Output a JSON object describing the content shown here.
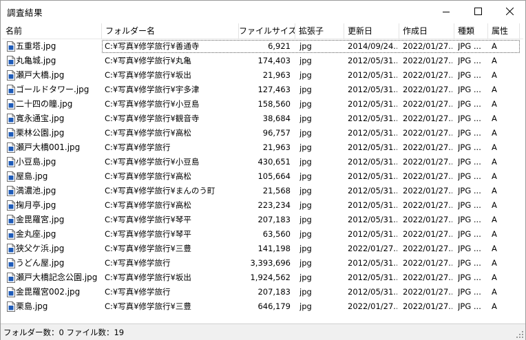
{
  "window": {
    "title": "調査結果"
  },
  "columns": [
    {
      "label": "名前"
    },
    {
      "label": "フォルダー名"
    },
    {
      "label": "ファイルサイズ"
    },
    {
      "label": "拡張子"
    },
    {
      "label": "更新日"
    },
    {
      "label": "作成日"
    },
    {
      "label": "種類"
    },
    {
      "label": "属性"
    }
  ],
  "rows": [
    {
      "name": "五重塔.jpg",
      "folder": "C:¥写真¥修学旅行¥善通寺",
      "size": "6,921",
      "ext": "jpg",
      "updated": "2014/09/24...",
      "created": "2022/01/27...",
      "type": "JPG ...",
      "attr": "A"
    },
    {
      "name": "丸亀城.jpg",
      "folder": "C:¥写真¥修学旅行¥丸亀",
      "size": "174,403",
      "ext": "jpg",
      "updated": "2012/05/31...",
      "created": "2022/01/27...",
      "type": "JPG ...",
      "attr": "A"
    },
    {
      "name": "瀬戸大橋.jpg",
      "folder": "C:¥写真¥修学旅行¥坂出",
      "size": "21,963",
      "ext": "jpg",
      "updated": "2012/05/31...",
      "created": "2022/01/27...",
      "type": "JPG ...",
      "attr": "A"
    },
    {
      "name": "ゴールドタワー.jpg",
      "folder": "C:¥写真¥修学旅行¥宇多津",
      "size": "127,463",
      "ext": "jpg",
      "updated": "2012/05/31...",
      "created": "2022/01/27...",
      "type": "JPG ...",
      "attr": "A"
    },
    {
      "name": "二十四の瞳.jpg",
      "folder": "C:¥写真¥修学旅行¥小豆島",
      "size": "158,560",
      "ext": "jpg",
      "updated": "2012/05/31...",
      "created": "2022/01/27...",
      "type": "JPG ...",
      "attr": "A"
    },
    {
      "name": "寛永通宝.jpg",
      "folder": "C:¥写真¥修学旅行¥観音寺",
      "size": "38,684",
      "ext": "jpg",
      "updated": "2012/05/31...",
      "created": "2022/01/27...",
      "type": "JPG ...",
      "attr": "A"
    },
    {
      "name": "栗林公園.jpg",
      "folder": "C:¥写真¥修学旅行¥高松",
      "size": "96,757",
      "ext": "jpg",
      "updated": "2012/05/31...",
      "created": "2022/01/27...",
      "type": "JPG ...",
      "attr": "A"
    },
    {
      "name": "瀬戸大橋001.jpg",
      "folder": "C:¥写真¥修学旅行",
      "size": "21,963",
      "ext": "jpg",
      "updated": "2012/05/31...",
      "created": "2022/01/27...",
      "type": "JPG ...",
      "attr": "A"
    },
    {
      "name": "小豆島.jpg",
      "folder": "C:¥写真¥修学旅行¥小豆島",
      "size": "430,651",
      "ext": "jpg",
      "updated": "2012/05/31...",
      "created": "2022/01/27...",
      "type": "JPG ...",
      "attr": "A"
    },
    {
      "name": "屋島.jpg",
      "folder": "C:¥写真¥修学旅行¥高松",
      "size": "105,664",
      "ext": "jpg",
      "updated": "2012/05/31...",
      "created": "2022/01/27...",
      "type": "JPG ...",
      "attr": "A"
    },
    {
      "name": "満濃池.jpg",
      "folder": "C:¥写真¥修学旅行¥まんのう町",
      "size": "21,568",
      "ext": "jpg",
      "updated": "2012/05/31...",
      "created": "2022/01/27...",
      "type": "JPG ...",
      "attr": "A"
    },
    {
      "name": "掬月亭.jpg",
      "folder": "C:¥写真¥修学旅行¥高松",
      "size": "223,234",
      "ext": "jpg",
      "updated": "2012/05/31...",
      "created": "2022/01/27...",
      "type": "JPG ...",
      "attr": "A"
    },
    {
      "name": "金毘羅宮.jpg",
      "folder": "C:¥写真¥修学旅行¥琴平",
      "size": "207,183",
      "ext": "jpg",
      "updated": "2012/05/31...",
      "created": "2022/01/27...",
      "type": "JPG ...",
      "attr": "A"
    },
    {
      "name": "金丸座.jpg",
      "folder": "C:¥写真¥修学旅行¥琴平",
      "size": "63,560",
      "ext": "jpg",
      "updated": "2012/05/31...",
      "created": "2022/01/27...",
      "type": "JPG ...",
      "attr": "A"
    },
    {
      "name": "狭父ケ浜.jpg",
      "folder": "C:¥写真¥修学旅行¥三豊",
      "size": "141,198",
      "ext": "jpg",
      "updated": "2022/01/27...",
      "created": "2022/01/27...",
      "type": "JPG ...",
      "attr": "A"
    },
    {
      "name": "うどん屋.jpg",
      "folder": "C:¥写真¥修学旅行",
      "size": "3,393,696",
      "ext": "jpg",
      "updated": "2012/05/31...",
      "created": "2022/01/27...",
      "type": "JPG ...",
      "attr": "A"
    },
    {
      "name": "瀬戸大橋記念公園.jpg",
      "folder": "C:¥写真¥修学旅行¥坂出",
      "size": "1,924,562",
      "ext": "jpg",
      "updated": "2012/05/31...",
      "created": "2022/01/27...",
      "type": "JPG ...",
      "attr": "A"
    },
    {
      "name": "金毘羅宮002.jpg",
      "folder": "C:¥写真¥修学旅行",
      "size": "207,183",
      "ext": "jpg",
      "updated": "2012/05/31...",
      "created": "2022/01/27...",
      "type": "JPG ...",
      "attr": "A"
    },
    {
      "name": "栗島.jpg",
      "folder": "C:¥写真¥修学旅行¥三豊",
      "size": "646,179",
      "ext": "jpg",
      "updated": "2022/01/27...",
      "created": "2022/01/27...",
      "type": "JPG ...",
      "attr": "A"
    }
  ],
  "selected_row": 0,
  "status": {
    "text": "フォルダー数：0 ファイル数：19"
  },
  "colors": {
    "icon_blue": "#1e5bb8",
    "status_bg": "#f0f0f0"
  }
}
